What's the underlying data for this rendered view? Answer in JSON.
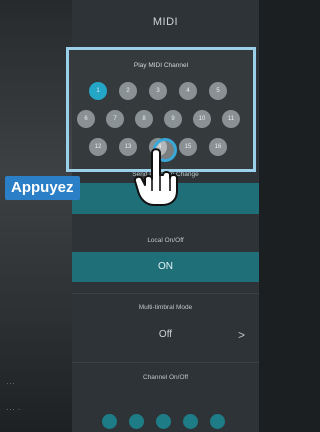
{
  "header": {
    "title": "MIDI"
  },
  "midi_channel": {
    "title": "Play MIDI Channel",
    "selected": "1",
    "rows": [
      [
        "1",
        "2",
        "3",
        "4",
        "5"
      ],
      [
        "6",
        "7",
        "8",
        "9",
        "10",
        "11"
      ],
      [
        "12",
        "13",
        "14",
        "15",
        "16"
      ]
    ]
  },
  "program_change": {
    "title": "Send Program Change"
  },
  "local_onoff": {
    "title": "Local On/Off",
    "value": "ON"
  },
  "multi_timbral": {
    "title": "Multi-timbral Mode",
    "value": "Off",
    "chevron": ">"
  },
  "channel_onoff": {
    "title": "Channel On/Off"
  },
  "tutorial": {
    "callout_label": "Appuyez",
    "colors": {
      "highlight": "#9ad0ea",
      "callout": "#2b7fc6",
      "accent": "#1f6f78",
      "selected": "#24a6c7"
    }
  }
}
